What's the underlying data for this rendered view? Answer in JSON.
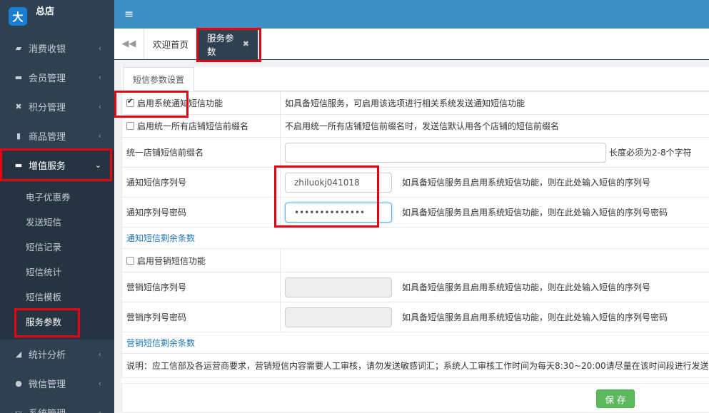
{
  "brand": {
    "name": "总店",
    "logo_icon": "person-run-icon"
  },
  "topbar": {
    "menu_icon": "hamburger-icon"
  },
  "sidebar": {
    "items": [
      {
        "label": "消费收银",
        "icon": "bag-icon"
      },
      {
        "label": "会员管理",
        "icon": "card-icon"
      },
      {
        "label": "积分管理",
        "icon": "crossed-tools-icon"
      },
      {
        "label": "商品管理",
        "icon": "barcode-icon"
      },
      {
        "label": "增值服务",
        "icon": "cart-icon"
      },
      {
        "label": "统计分析",
        "icon": "area-chart-icon"
      },
      {
        "label": "微信管理",
        "icon": "wechat-icon"
      },
      {
        "label": "系统管理",
        "icon": "monitor-icon"
      }
    ],
    "submenu": [
      "电子优惠券",
      "发送短信",
      "短信记录",
      "短信统计",
      "短信模板",
      "服务参数"
    ]
  },
  "tabs": {
    "home": "欢迎首页",
    "active": "服务参数"
  },
  "panel": {
    "subtab": "短信参数设置",
    "rows": {
      "enable_sys": {
        "label": "启用系统通知短信功能",
        "desc": "如具备短信服务，可启用该选项进行相关系统发送通知短信功能"
      },
      "enable_prefix": {
        "label": "启用统一所有店铺短信前缀名",
        "desc": "不启用统一所有店铺短信前缀名时，发送信默认用各个店铺的短信前缀名"
      },
      "prefix": {
        "label": "统一店铺短信前缀名",
        "value": "",
        "hint": "长度必须为2-8个字符"
      },
      "notify_serial": {
        "label": "通知短信序列号",
        "value": "zhiluokj041018",
        "hint": "如具备短信服务且启用系统短信功能，则在此处输入短信的序列号"
      },
      "notify_password": {
        "label": "通知序列号密码",
        "value": "••••••••••••••",
        "hint": "如具备短信服务且启用系统短信功能，则在此处输入短信的序列号密码"
      },
      "notify_remain": {
        "label": "通知短信剩余条数"
      },
      "enable_marketing": {
        "label": "启用营销短信功能"
      },
      "marketing_serial": {
        "label": "营销短信序列号",
        "hint": "如具备短信服务且启用系统短信功能，则在此处输入短信的序列号"
      },
      "marketing_password": {
        "label": "营销序列号密码",
        "hint": "如具备短信服务且启用系统短信功能，则在此处输入短信的序列号密码"
      },
      "marketing_remain": {
        "label": "营销短信剩余条数"
      },
      "notice": "说明：应工信部及各运营商要求，营销短信内容需要人工审核，请勿发送敏感词汇；系统人工审核工作时间为每天8:30~20:00请尽量在该时间段进行发送，"
    },
    "save_label": "保 存"
  },
  "colors": {
    "sidebar": "#2f4050",
    "topbar": "#3d8fc4",
    "save": "#5cb85c",
    "highlight": "#e60012",
    "notice": "#d40000"
  }
}
